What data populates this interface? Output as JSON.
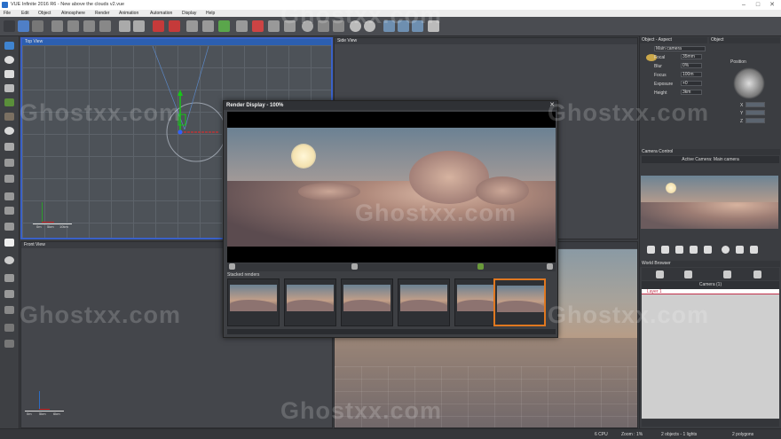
{
  "window": {
    "title": "VUE Infinite 2016 R6 - New above the clouds v2.vue"
  },
  "menu": [
    "File",
    "Edit",
    "Object",
    "Atmosphere",
    "Render",
    "Animation",
    "Automation",
    "Display",
    "Help"
  ],
  "viewports": {
    "top": "Top View",
    "side": "Side View",
    "front": "Front View"
  },
  "scale_top": [
    "0m",
    "5km",
    "10km"
  ],
  "scale_front": [
    "0m",
    "5km",
    "6km"
  ],
  "render_display": {
    "title": "Render Display - 100%",
    "stacked_label": "Stacked renders",
    "thumb_count": 6
  },
  "object_panel": {
    "header": "Object - Aspect",
    "tab": "Object",
    "camera_name": "Main camera",
    "rows": [
      {
        "label": "Focal",
        "value": "35mm"
      },
      {
        "label": "Blur",
        "value": "0%"
      },
      {
        "label": "Focus",
        "value": "100m"
      },
      {
        "label": "Exposure",
        "value": "+0"
      },
      {
        "label": "Height",
        "value": "3km"
      }
    ],
    "position_label": "Position",
    "xyz": [
      "X",
      "Y",
      "Z"
    ]
  },
  "camera_control": {
    "header": "Camera Control",
    "active": "Active Camera: Main camera"
  },
  "world_browser": {
    "header": "World Browser",
    "camera_item": "Camera (1)",
    "layer_item": "Layer 1"
  },
  "status": {
    "cpu": "6 CPU",
    "zoom": "Zoom : 1%",
    "objects": "2 objects - 1 lights",
    "polygons": "2 polygons"
  },
  "watermark": "Ghostxx.com",
  "colors": {
    "accent": "#2c5fb0",
    "selected_thumb": "#e07820",
    "layer": "#c0304a"
  }
}
